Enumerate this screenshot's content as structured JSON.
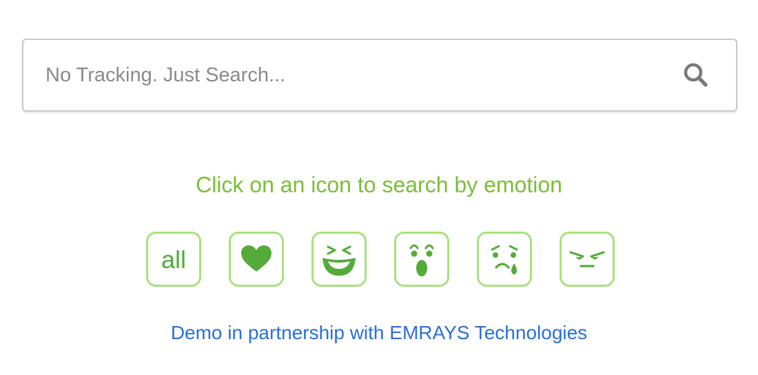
{
  "search": {
    "placeholder": "No Tracking. Just Search...",
    "value": "",
    "button_icon": "search-icon"
  },
  "prompt": "Click on an icon to search by emotion",
  "emotions": [
    {
      "id": "all",
      "label": "all",
      "icon": "all-text"
    },
    {
      "id": "love",
      "label": "",
      "icon": "heart-icon"
    },
    {
      "id": "joy",
      "label": "",
      "icon": "laughing-face-icon"
    },
    {
      "id": "surprise",
      "label": "",
      "icon": "surprised-face-icon"
    },
    {
      "id": "sadness",
      "label": "",
      "icon": "crying-face-icon"
    },
    {
      "id": "anger",
      "label": "",
      "icon": "angry-face-icon"
    }
  ],
  "partner_link": "Demo in partnership with EMRAYS Technologies",
  "colors": {
    "accent_green": "#7cbd3a",
    "icon_green": "#55ab3a",
    "icon_border": "#a8e07e",
    "link_blue": "#2a6fd6",
    "search_border": "#c9c9c9"
  }
}
